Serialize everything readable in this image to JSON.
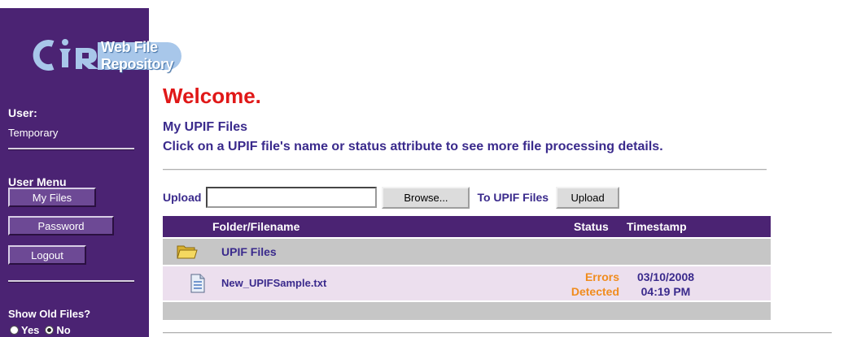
{
  "brand": {
    "logo_letters": "CIR",
    "app_name": "Web File Repository"
  },
  "sidebar": {
    "user_label": "User:",
    "user_name": "Temporary",
    "menu_label": "User Menu",
    "menu_items": [
      {
        "label": "My Files",
        "active": true
      },
      {
        "label": "Password"
      },
      {
        "label": "Logout"
      }
    ],
    "show_old_label": "Show Old Files?",
    "show_old_options": [
      {
        "label": "Yes",
        "selected": false
      },
      {
        "label": "No",
        "selected": true
      }
    ]
  },
  "main": {
    "welcome": "Welcome.",
    "section_title": "My UPIF Files",
    "instructions": "Click on a UPIF file's name or status attribute to see more file processing details."
  },
  "upload": {
    "label": "Upload",
    "file_value": "",
    "browse_label": "Browse...",
    "destination_label": "To UPIF Files",
    "upload_button_label": "Upload"
  },
  "table": {
    "headers": {
      "name": "Folder/Filename",
      "status": "Status",
      "timestamp": "Timestamp"
    },
    "folder": {
      "name": "UPIF Files",
      "icon": "folder-icon"
    },
    "files": [
      {
        "name": "New_UPIFSample.txt",
        "icon": "text-file-icon",
        "status_line1": "Errors",
        "status_line2": "Detected",
        "date": "03/10/2008",
        "time": "04:19 PM"
      }
    ]
  },
  "colors": {
    "sidebar_bg": "#4b2373",
    "welcome": "#e01818",
    "heading_text": "#3a2a8c",
    "status_warning": "#f08c1e",
    "folder_row": "#c6c6c6",
    "file_row": "#ecdfee"
  }
}
